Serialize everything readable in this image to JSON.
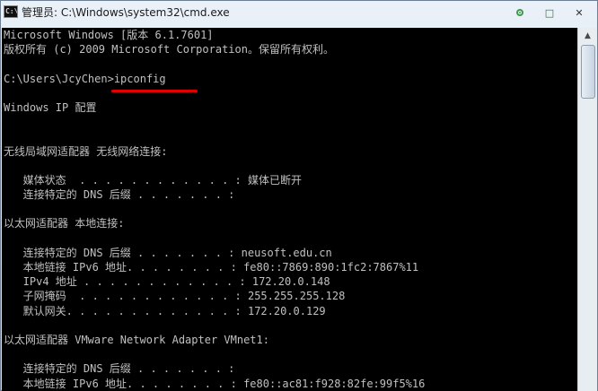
{
  "window": {
    "title": "管理员: C:\\Windows\\system32\\cmd.exe",
    "icon": "cmd-icon",
    "icon_text": "C:\\",
    "buttons": {
      "minimize": "minimize-icon",
      "maximize": "□",
      "close": "✕"
    }
  },
  "console": {
    "lines": [
      "Microsoft Windows [版本 6.1.7601]",
      "版权所有 (c) 2009 Microsoft Corporation。保留所有权利。",
      "",
      "C:\\Users\\JcyChen>ipconfig",
      "",
      "Windows IP 配置",
      "",
      "",
      "无线局域网适配器 无线网络连接:",
      "",
      "   媒体状态  . . . . . . . . . . . . : 媒体已断开",
      "   连接特定的 DNS 后缀 . . . . . . . :",
      "",
      "以太网适配器 本地连接:",
      "",
      "   连接特定的 DNS 后缀 . . . . . . . : neusoft.edu.cn",
      "   本地链接 IPv6 地址. . . . . . . . : fe80::7869:890:1fc2:7867%11",
      "   IPv4 地址 . . . . . . . . . . . . : 172.20.0.148",
      "   子网掩码  . . . . . . . . . . . . : 255.255.255.128",
      "   默认网关. . . . . . . . . . . . . : 172.20.0.129",
      "",
      "以太网适配器 VMware Network Adapter VMnet1:",
      "",
      "   连接特定的 DNS 后缀 . . . . . . . :",
      "   本地链接 IPv6 地址. . . . . . . . : fe80::ac81:f928:82fe:99f5%16"
    ],
    "annotation_color": "#e00000"
  },
  "scrollbar": {
    "up_arrow": "▲"
  }
}
